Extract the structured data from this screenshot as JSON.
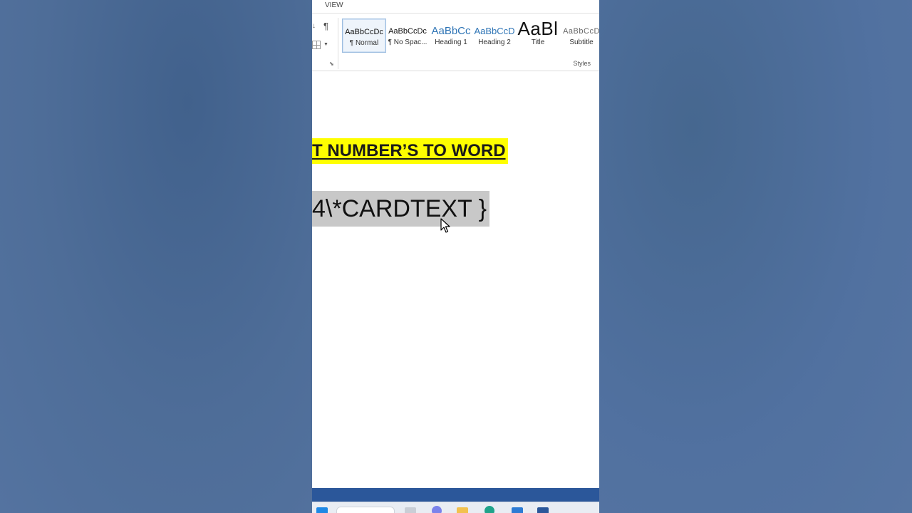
{
  "ribbon": {
    "tab_view": "VIEW",
    "paragraph_mark": "¶",
    "styles_group_label": "Styles",
    "styles": [
      {
        "sample": "AaBbCcDc",
        "label": "¶ Normal"
      },
      {
        "sample": "AaBbCcDc",
        "label": "¶ No Spac..."
      },
      {
        "sample": "AaBbCc",
        "label": "Heading 1"
      },
      {
        "sample": "AaBbCcD",
        "label": "Heading 2"
      },
      {
        "sample": "AaBl",
        "label": "Title"
      },
      {
        "sample": "AaBbCcD",
        "label": "Subtitle"
      }
    ]
  },
  "document": {
    "heading": "T NUMBER’S TO WORD",
    "field_code": "4\\*CARDTEXT }"
  },
  "colors": {
    "highlight": "#ffff00",
    "field_shading": "#c8c8c8",
    "statusbar": "#2b579a",
    "heading_style": "#2e74b5"
  }
}
